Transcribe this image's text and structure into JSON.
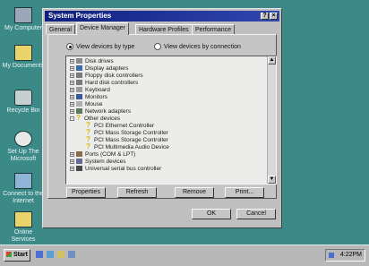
{
  "desktop": {
    "icons": [
      {
        "label": "My Computer",
        "icon": "computer-icon"
      },
      {
        "label": "My Documents",
        "icon": "folder-icon"
      },
      {
        "label": "Recycle Bin",
        "icon": "recycle-bin-icon"
      },
      {
        "label": "Set Up The Microsoft",
        "icon": "msn-icon"
      },
      {
        "label": "Connect to the Internet",
        "icon": "internet-icon"
      },
      {
        "label": "Online Services",
        "icon": "folder-icon"
      }
    ]
  },
  "window": {
    "title": "System Properties",
    "help_label": "?",
    "close_label": "×",
    "tabs": [
      "General",
      "Device Manager",
      "Hardware Profiles",
      "Performance"
    ],
    "active_tab": "Device Manager",
    "view_by_type_label": "View devices by type",
    "view_by_connection_label": "View devices by connection",
    "tree_items": [
      {
        "label": "Disk drives",
        "expander": "+",
        "icon": "disk-drive-icon"
      },
      {
        "label": "Display adapters",
        "expander": "+",
        "icon": "display-adapter-icon"
      },
      {
        "label": "Floppy disk controllers",
        "expander": "+",
        "icon": "controller-icon"
      },
      {
        "label": "Hard disk controllers",
        "expander": "+",
        "icon": "controller-icon"
      },
      {
        "label": "Keyboard",
        "expander": "+",
        "icon": "keyboard-icon"
      },
      {
        "label": "Monitors",
        "expander": "+",
        "icon": "monitor-icon"
      },
      {
        "label": "Mouse",
        "expander": "+",
        "icon": "mouse-icon"
      },
      {
        "label": "Network adapters",
        "expander": "+",
        "icon": "network-icon"
      },
      {
        "label": "Other devices",
        "expander": "-",
        "icon": "question-icon"
      },
      {
        "label": "PCI Ethernet Controller",
        "expander": "",
        "icon": "question-icon"
      },
      {
        "label": "PCI Mass Storage Controller",
        "expander": "",
        "icon": "question-icon"
      },
      {
        "label": "PCI Mass Storage Controller",
        "expander": "",
        "icon": "question-icon"
      },
      {
        "label": "PCI Multimedia Audio Device",
        "expander": "",
        "icon": "question-icon"
      },
      {
        "label": "Ports (COM & LPT)",
        "expander": "+",
        "icon": "port-icon"
      },
      {
        "label": "System devices",
        "expander": "+",
        "icon": "system-icon"
      },
      {
        "label": "Universal serial bus controller",
        "expander": "+",
        "icon": "usb-icon"
      }
    ],
    "buttons": {
      "properties": "Properties",
      "refresh": "Refresh",
      "remove": "Remove",
      "print": "Print..."
    },
    "ok_label": "OK",
    "cancel_label": "Cancel"
  },
  "taskbar": {
    "start_label": "Start",
    "clock": "4:22PM"
  },
  "colors": {
    "desktop": "#3c8a88",
    "titlebar": "#0f1f7c",
    "question_mark": "#d8b400"
  }
}
